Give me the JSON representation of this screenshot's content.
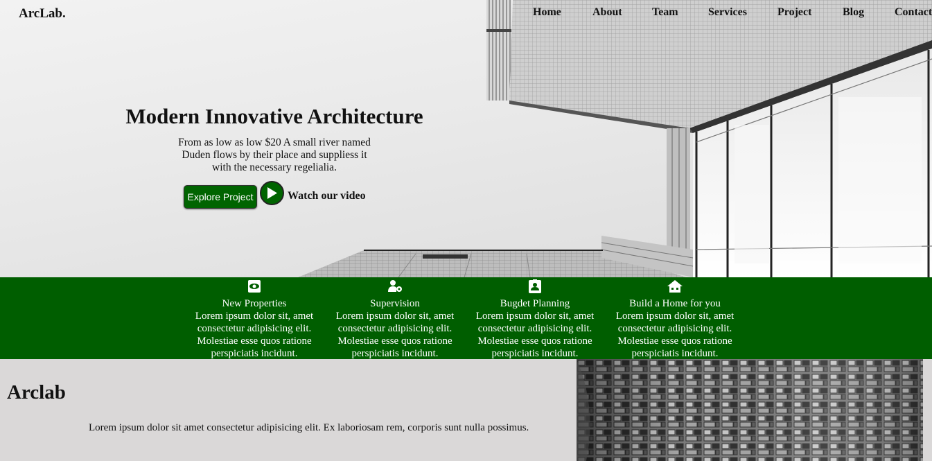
{
  "brand": {
    "logo": "ArcLab."
  },
  "nav": {
    "items": [
      {
        "label": "Home"
      },
      {
        "label": "About"
      },
      {
        "label": "Team"
      },
      {
        "label": "Services"
      },
      {
        "label": "Project"
      },
      {
        "label": "Blog"
      },
      {
        "label": "Contact"
      }
    ]
  },
  "hero": {
    "title": "Modern Innovative Architecture",
    "text": "From as low as low $20 A small river named Duden flows by their place and suppliess it with the necessary regelialia.",
    "explore_label": "Explore Project",
    "watch_label": "Watch our video"
  },
  "services": {
    "items": [
      {
        "icon": "eye-icon",
        "title": "New Properties",
        "text": "Lorem ipsum dolor sit, amet consectetur adipisicing elit. Molestiae esse quos ratione perspiciatis incidunt."
      },
      {
        "icon": "user-gear-icon",
        "title": "Supervision",
        "text": "Lorem ipsum dolor sit, amet consectetur adipisicing elit. Molestiae esse quos ratione perspiciatis incidunt."
      },
      {
        "icon": "id-badge-icon",
        "title": "Bugdet Planning",
        "text": "Lorem ipsum dolor sit, amet consectetur adipisicing elit. Molestiae esse quos ratione perspiciatis incidunt."
      },
      {
        "icon": "house-icon",
        "title": "Build a Home for you",
        "text": "Lorem ipsum dolor sit, amet consectetur adipisicing elit. Molestiae esse quos ratione perspiciatis incidunt."
      }
    ]
  },
  "about": {
    "title": "Arclab",
    "text": "Lorem ipsum dolor sit amet consectetur adipisicing elit. Ex laboriosam rem, corporis sunt nulla possimus."
  },
  "colors": {
    "accent": "#006400",
    "band": "#005e00",
    "about_bg": "#dad8d8"
  }
}
